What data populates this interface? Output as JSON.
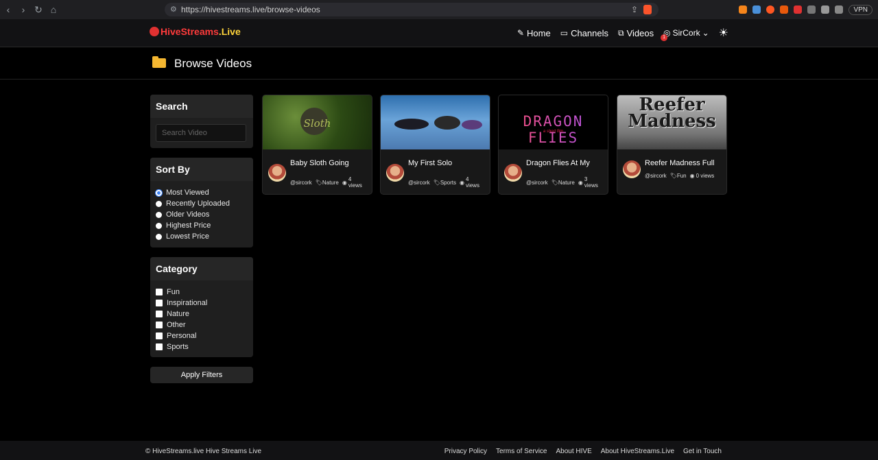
{
  "browser": {
    "url": "https://hivestreams.live/browse-videos",
    "vpn_label": "VPN"
  },
  "header": {
    "logo": {
      "hive": "Hive",
      "streams": "Streams",
      "live": ".Live"
    },
    "nav": {
      "home": "Home",
      "channels": "Channels",
      "videos": "Videos"
    },
    "notification_count": "1",
    "user_name": "SirCork"
  },
  "page": {
    "title": "Browse Videos"
  },
  "sidebar": {
    "search": {
      "heading": "Search",
      "placeholder": "Search Video"
    },
    "sort": {
      "heading": "Sort By",
      "options": [
        "Most Viewed",
        "Recently Uploaded",
        "Older Videos",
        "Highest Price",
        "Lowest Price"
      ],
      "selected": "Most Viewed"
    },
    "category": {
      "heading": "Category",
      "options": [
        "Fun",
        "Inspirational",
        "Nature",
        "Other",
        "Personal",
        "Sports"
      ]
    },
    "apply_label": "Apply Filters"
  },
  "videos": [
    {
      "title": "Baby Sloth Going",
      "thumb_text": "Sloth",
      "author": "@sircork",
      "category": "Nature",
      "views_count": "4",
      "views_unit": "views"
    },
    {
      "title": "My First Solo",
      "author": "@sircork",
      "category": "Sports",
      "views_count": "4",
      "views_unit": "views"
    },
    {
      "title": "Dragon Flies At My",
      "thumb_text": "DRAGON FLIES",
      "thumb_sub": "a short film",
      "author": "@sircork",
      "category": "Nature",
      "views_count": "3",
      "views_unit": "views"
    },
    {
      "title": "Reefer Madness Full",
      "thumb_text": "Reefer Madness",
      "author": "@sircork",
      "category": "Fun",
      "views_label": "0 views"
    }
  ],
  "footer": {
    "copyright": "© HiveStreams.live Hive Streams Live",
    "links": [
      "Privacy Policy",
      "Terms of Service",
      "About HIVE",
      "About HiveStreams.Live",
      "Get in Touch"
    ]
  },
  "colors": {
    "accent_blue": "#3b82f6",
    "brand_red": "#ff3b3b",
    "brand_yellow": "#ffd43b"
  }
}
